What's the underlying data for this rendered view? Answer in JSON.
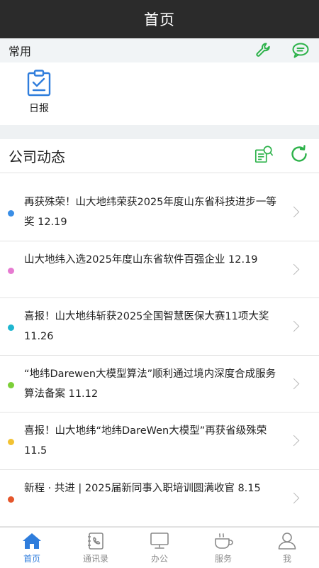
{
  "header": {
    "title": "首页"
  },
  "common": {
    "label": "常用",
    "apps": [
      {
        "label": "日报",
        "icon": "clipboard-check-icon"
      }
    ]
  },
  "news": {
    "label": "公司动态",
    "items": [
      {
        "text": "再获殊荣！山大地纬荣获2025年度山东省科技进步一等奖 12.19",
        "dot_color": "#3a8ee6"
      },
      {
        "text": "山大地纬入选2025年度山东省软件百强企业 12.19",
        "dot_color": "#e67ad1"
      },
      {
        "text": "喜报！山大地纬斩获2025全国智慧医保大赛11项大奖 11.26",
        "dot_color": "#1fb6d0"
      },
      {
        "text": "“地纬Darewen大模型算法”顺利通过境内深度合成服务算法备案 11.12",
        "dot_color": "#7ccf38"
      },
      {
        "text": "喜报！山大地纬“地纬DareWen大模型”再获省级殊荣 11.5",
        "dot_color": "#f2c232"
      },
      {
        "text": "新程 · 共进 | 2025届新同事入职培训圆满收官 8.15",
        "dot_color": "#e5562b"
      }
    ]
  },
  "tabs": [
    {
      "label": "首页",
      "icon": "home-icon",
      "active": true
    },
    {
      "label": "通讯录",
      "icon": "contacts-icon",
      "active": false
    },
    {
      "label": "办公",
      "icon": "monitor-icon",
      "active": false
    },
    {
      "label": "服务",
      "icon": "coffee-cup-icon",
      "active": false
    },
    {
      "label": "我",
      "icon": "user-icon",
      "active": false
    }
  ],
  "colors": {
    "accent_green": "#2db24a",
    "accent_blue": "#2f7ddc",
    "titlebar": "#2b2b2b"
  }
}
